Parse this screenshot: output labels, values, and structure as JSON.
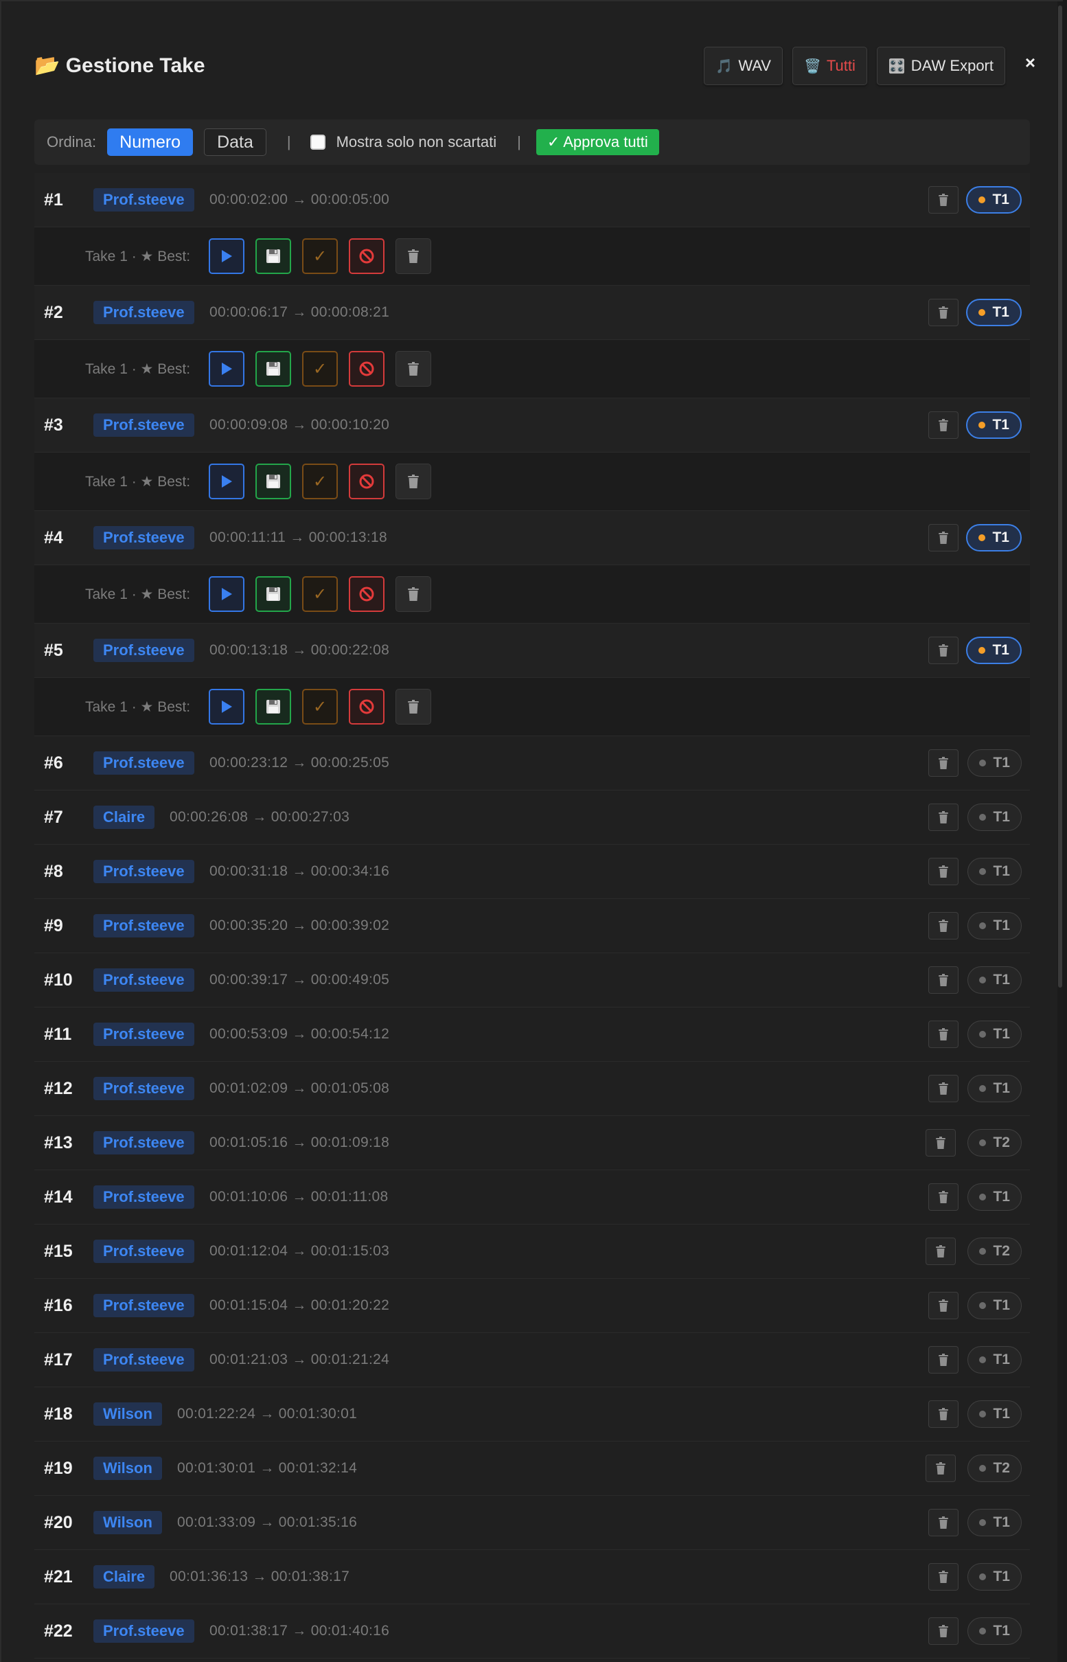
{
  "title": "📂 Gestione Take",
  "header_buttons": {
    "wav": {
      "icon": "🎵",
      "label": "WAV"
    },
    "all": {
      "icon": "🗑️",
      "label": "Tutti"
    },
    "daw": {
      "icon": "🎛️",
      "label": "DAW Export"
    },
    "close": "×"
  },
  "toolbar": {
    "sort_label": "Ordina:",
    "sort_number": "Numero",
    "sort_date": "Data",
    "separator": "|",
    "filter_label": "Mostra solo non scartati",
    "approve_all": "✓ Approva tutti"
  },
  "take_row": {
    "label": "Take 1 · ★ Best:",
    "check_glyph": "✓"
  },
  "colors": {
    "accent": "#2f7cf0",
    "approve": "#22b04c",
    "danger": "#e64b4b",
    "take_dot": "#f59e28"
  },
  "rows": [
    {
      "num": "#1",
      "speaker": "Prof.steeve",
      "time": "00:00:02:00 → 00:00:05:00",
      "take": "T1",
      "expanded": true
    },
    {
      "num": "#2",
      "speaker": "Prof.steeve",
      "time": "00:00:06:17 → 00:00:08:21",
      "take": "T1",
      "expanded": true
    },
    {
      "num": "#3",
      "speaker": "Prof.steeve",
      "time": "00:00:09:08 → 00:00:10:20",
      "take": "T1",
      "expanded": true
    },
    {
      "num": "#4",
      "speaker": "Prof.steeve",
      "time": "00:00:11:11 → 00:00:13:18",
      "take": "T1",
      "expanded": true
    },
    {
      "num": "#5",
      "speaker": "Prof.steeve",
      "time": "00:00:13:18 → 00:00:22:08",
      "take": "T1",
      "expanded": true
    },
    {
      "num": "#6",
      "speaker": "Prof.steeve",
      "time": "00:00:23:12 → 00:00:25:05",
      "take": "T1",
      "expanded": false
    },
    {
      "num": "#7",
      "speaker": "Claire",
      "time": "00:00:26:08 → 00:00:27:03",
      "take": "T1",
      "expanded": false
    },
    {
      "num": "#8",
      "speaker": "Prof.steeve",
      "time": "00:00:31:18 → 00:00:34:16",
      "take": "T1",
      "expanded": false
    },
    {
      "num": "#9",
      "speaker": "Prof.steeve",
      "time": "00:00:35:20 → 00:00:39:02",
      "take": "T1",
      "expanded": false
    },
    {
      "num": "#10",
      "speaker": "Prof.steeve",
      "time": "00:00:39:17 → 00:00:49:05",
      "take": "T1",
      "expanded": false
    },
    {
      "num": "#11",
      "speaker": "Prof.steeve",
      "time": "00:00:53:09 → 00:00:54:12",
      "take": "T1",
      "expanded": false
    },
    {
      "num": "#12",
      "speaker": "Prof.steeve",
      "time": "00:01:02:09 → 00:01:05:08",
      "take": "T1",
      "expanded": false
    },
    {
      "num": "#13",
      "speaker": "Prof.steeve",
      "time": "00:01:05:16 → 00:01:09:18",
      "take": "T2",
      "expanded": false
    },
    {
      "num": "#14",
      "speaker": "Prof.steeve",
      "time": "00:01:10:06 → 00:01:11:08",
      "take": "T1",
      "expanded": false
    },
    {
      "num": "#15",
      "speaker": "Prof.steeve",
      "time": "00:01:12:04 → 00:01:15:03",
      "take": "T2",
      "expanded": false
    },
    {
      "num": "#16",
      "speaker": "Prof.steeve",
      "time": "00:01:15:04 → 00:01:20:22",
      "take": "T1",
      "expanded": false
    },
    {
      "num": "#17",
      "speaker": "Prof.steeve",
      "time": "00:01:21:03 → 00:01:21:24",
      "take": "T1",
      "expanded": false
    },
    {
      "num": "#18",
      "speaker": "Wilson",
      "time": "00:01:22:24 → 00:01:30:01",
      "take": "T1",
      "expanded": false
    },
    {
      "num": "#19",
      "speaker": "Wilson",
      "time": "00:01:30:01 → 00:01:32:14",
      "take": "T2",
      "expanded": false
    },
    {
      "num": "#20",
      "speaker": "Wilson",
      "time": "00:01:33:09 → 00:01:35:16",
      "take": "T1",
      "expanded": false
    },
    {
      "num": "#21",
      "speaker": "Claire",
      "time": "00:01:36:13 → 00:01:38:17",
      "take": "T1",
      "expanded": false
    },
    {
      "num": "#22",
      "speaker": "Prof.steeve",
      "time": "00:01:38:17 → 00:01:40:16",
      "take": "T1",
      "expanded": false
    }
  ]
}
